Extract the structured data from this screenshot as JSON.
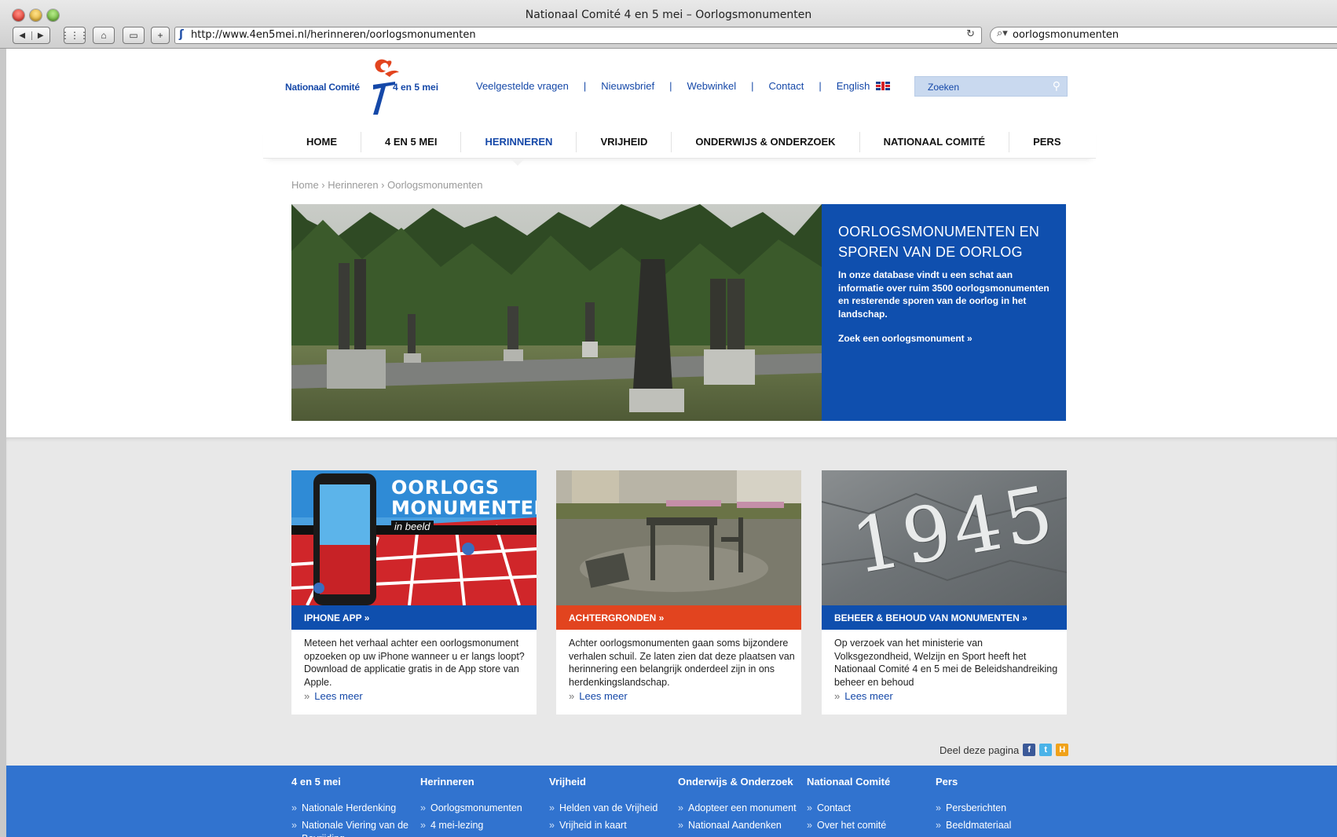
{
  "window": {
    "title": "Nationaal Comité 4 en 5 mei – Oorlogsmonumenten",
    "url": "http://www.4en5mei.nl/herinneren/oorlogsmonumenten",
    "search_query": "oorlogsmonumenten"
  },
  "logo": {
    "left_text": "Nationaal Comité",
    "right_text": "4 en 5 mei"
  },
  "topnav": {
    "items": [
      "Veelgestelde vragen",
      "Nieuwsbrief",
      "Webwinkel",
      "Contact",
      "English"
    ]
  },
  "site_search": {
    "placeholder": "Zoeken"
  },
  "mainnav": {
    "items": [
      "HOME",
      "4 EN 5 MEI",
      "HERINNEREN",
      "VRIJHEID",
      "ONDERWIJS & ONDERZOEK",
      "NATIONAAL COMITÉ",
      "PERS"
    ],
    "active": "HERINNEREN"
  },
  "breadcrumb": "Home › Herinneren › Oorlogsmonumenten",
  "hero": {
    "title": "OORLOGSMONUMENTEN EN SPOREN VAN DE OORLOG",
    "text": "In onze database vindt u een schat aan informatie over ruim 3500 oorlogsmonumenten en resterende sporen van de oorlog in het landschap.",
    "cta": "Zoek een oorlogsmonument »"
  },
  "cards": [
    {
      "bar": "IPHONE APP »",
      "text": "Meteen het verhaal achter een oorlogsmonument opzoeken op uw iPhone wanneer u er langs loopt? Download de applicatie gratis in de App store van Apple.",
      "more": "Lees meer",
      "thumb_title_1": "OORLOGS",
      "thumb_title_2": "MONUMENTEN",
      "thumb_sub": "in beeld"
    },
    {
      "bar": "ACHTERGRONDEN »",
      "text": "Achter oorlogsmonumenten gaan soms bijzondere verhalen schuil. Ze laten zien dat deze plaatsen van herinnering een belangrijk onderdeel zijn in ons herdenkingslandschap.",
      "more": "Lees meer"
    },
    {
      "bar": "BEHEER & BEHOUD VAN MONUMENTEN »",
      "text": "Op verzoek van het ministerie van Volksgezondheid, Welzijn en Sport heeft het Nationaal Comité 4 en 5 mei de Beleidshandreiking beheer en behoud",
      "more": "Lees meer",
      "thumb_text": "1945"
    }
  ],
  "share": {
    "label": "Deel deze pagina"
  },
  "footer": {
    "columns": [
      {
        "heading": "4 en 5 mei",
        "links": [
          "Nationale Herdenking",
          "Nationale Viering van de Bevrijding"
        ]
      },
      {
        "heading": "Herinneren",
        "links": [
          "Oorlogsmonumenten",
          "4 mei-lezing"
        ]
      },
      {
        "heading": "Vrijheid",
        "links": [
          "Helden van de Vrijheid",
          "Vrijheid in kaart"
        ]
      },
      {
        "heading": "Onderwijs & Onderzoek",
        "links": [
          "Adopteer een monument",
          "Nationaal Aandenken"
        ]
      },
      {
        "heading": "Nationaal Comité",
        "links": [
          "Contact",
          "Over het comité"
        ]
      },
      {
        "heading": "Pers",
        "links": [
          "Persberichten",
          "Beeldmateriaal"
        ]
      }
    ]
  },
  "colors": {
    "brand_blue": "#1548a8",
    "hero_panel": "#0f4fae",
    "card_bar_blue": "#0f4fae",
    "card_bar_red": "#e2441f",
    "footer": "#3173cf"
  }
}
